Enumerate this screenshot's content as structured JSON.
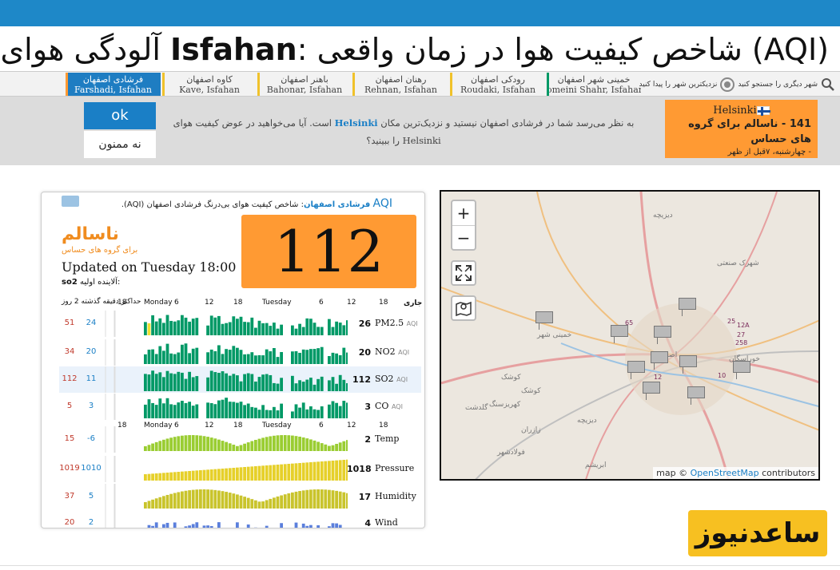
{
  "title": {
    "prefix": "آلودگی هوای ",
    "city": "Isfahan",
    "suffix": ": شاخص کیفیت هوا در زمان واقعی (AQI)"
  },
  "stations": [
    {
      "fa": "فرشادی اصفهان",
      "en": "Farshadi, Isfahan",
      "color": "#ff9a33",
      "active": true
    },
    {
      "fa": "کاوه اصفهان",
      "en": "Kave, Isfahan",
      "color": "#f0c22b",
      "active": false
    },
    {
      "fa": "باهنر اصفهان",
      "en": "Bahonar, Isfahan",
      "color": "#f0c22b",
      "active": false
    },
    {
      "fa": "رهنان اصفهان",
      "en": "Rehnan, Isfahan",
      "color": "#f0c22b",
      "active": false
    },
    {
      "fa": "رودکی اصفهان",
      "en": "Roudaki, Isfahan",
      "color": "#f0c22b",
      "active": false
    },
    {
      "fa": "خمینی شهر اصفهان",
      "en": "omeini Shahr, Isfahan",
      "color": "#009966",
      "active": false
    }
  ],
  "search": {
    "nearest": "نزدیکترین شهر را پیدا کنید",
    "search": "شهر دیگری را جستجو کنید"
  },
  "suggest": {
    "ok": "ok",
    "no": "نه ممنون",
    "line1a": "به نظر می‌رسد شما در فرشادی اصفهان نیستید و نزدیک‌ترین مکان ",
    "city": "Helsinki",
    "line1b": " است. آیا می‌خواهید در عوض کیفیت هوای",
    "line2": "Helsinki را ببینید؟"
  },
  "helsinki": {
    "name": "Helsinki",
    "aqi_line": "141 - ناسالم برای گروه های حساس",
    "time": "- چهارشنبه، ۷قبل از ظهر"
  },
  "panel": {
    "aqi_label": "AQI",
    "station": "فرشادی اصفهان",
    "desc": ": شاخص کیفیت هوای بی‌درنگ فرشادی اصفهان (AQI).",
    "aqi": "112",
    "status": "ناسالم",
    "status_sub": "برای گروه های حساس",
    "updated": "Updated on Tuesday 18:00",
    "primary_label": "آلاینده اولیه:",
    "primary": "so2",
    "hdr": "حداکثر  دقیقه  گذشته  2 روز",
    "current": "جاری"
  },
  "time_axis": [
    "18",
    "Monday",
    "6",
    "12",
    "18",
    "Tuesday",
    "6",
    "12",
    "18"
  ],
  "rows": [
    {
      "name": "PM2.5",
      "tag": "AQI",
      "max": "51",
      "min": "24",
      "cur": "26",
      "color": "#009966"
    },
    {
      "name": "NO2",
      "tag": "AQI",
      "max": "34",
      "min": "20",
      "cur": "20",
      "color": "#009966"
    },
    {
      "name": "SO2",
      "tag": "AQI",
      "max": "112",
      "min": "11",
      "cur": "112",
      "color": "#009966",
      "hl": true
    },
    {
      "name": "CO",
      "tag": "AQI",
      "max": "5",
      "min": "3",
      "cur": "3",
      "color": "#009966"
    },
    {
      "name": "Temp",
      "tag": "",
      "max": "15",
      "min": "-6",
      "cur": "2",
      "color": "#9acd32"
    },
    {
      "name": "Pressure",
      "tag": "",
      "max": "1019",
      "min": "1010",
      "cur": "1018",
      "color": "#e6d02a"
    },
    {
      "name": "Humidity",
      "tag": "",
      "max": "37",
      "min": "5",
      "cur": "17",
      "color": "#c9c42c"
    },
    {
      "name": "Wind",
      "tag": "",
      "max": "20",
      "min": "2",
      "cur": "4",
      "color": "#5b7fdc"
    }
  ],
  "map": {
    "zoom_in": "+",
    "zoom_out": "−",
    "attr_prefix": "map © ",
    "attr_link": "OpenStreetMap",
    "attr_suffix": " contributors",
    "towns": [
      "کهریزسنگ",
      "گلدشت",
      "کوشک",
      "اصفهان",
      "خمینی شهر",
      "دیزیچه",
      "زازران",
      "ابریشم",
      "فولادشهر",
      "شهرک صنعتی",
      "خوراسگان"
    ],
    "marker_labels": [
      "65",
      "12",
      "10",
      "27",
      "258",
      "12A",
      "25"
    ]
  },
  "logo": "ساعدنیوز"
}
